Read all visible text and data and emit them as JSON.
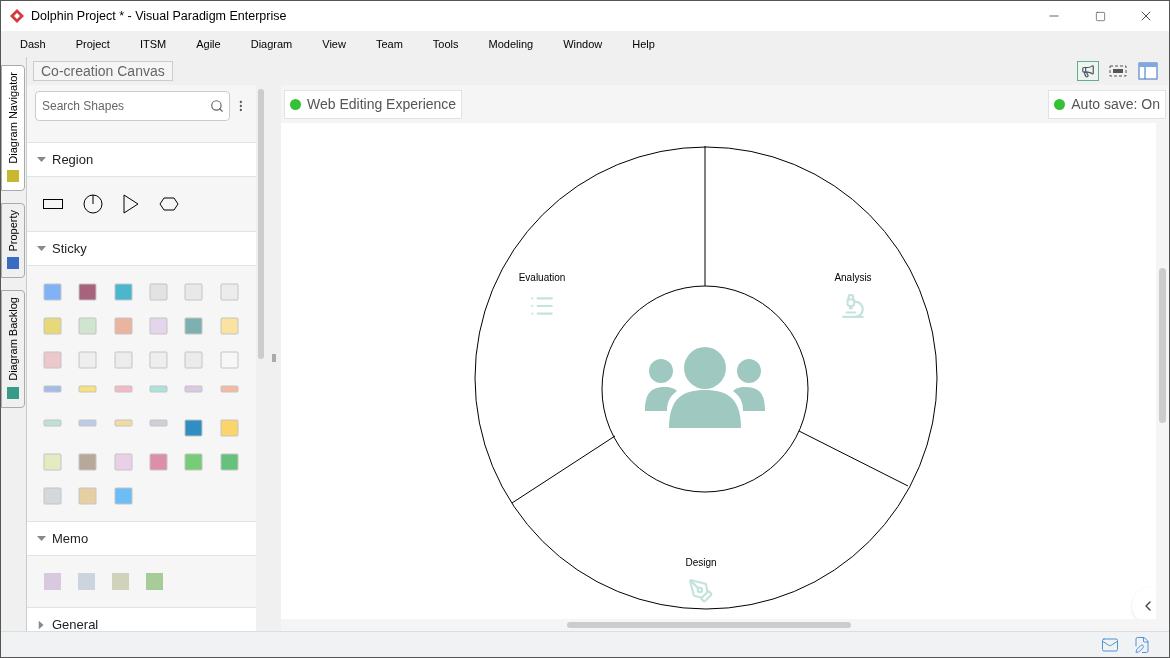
{
  "window": {
    "title": "Dolphin Project * - Visual Paradigm Enterprise"
  },
  "menu": [
    "Dash",
    "Project",
    "ITSM",
    "Agile",
    "Diagram",
    "View",
    "Team",
    "Tools",
    "Modeling",
    "Window",
    "Help"
  ],
  "side_tabs": [
    {
      "label": "Diagram Navigator",
      "selected": true
    },
    {
      "label": "Property",
      "selected": false
    },
    {
      "label": "Diagram Backlog",
      "selected": false
    }
  ],
  "breadcrumb": "Co-creation Canvas",
  "search": {
    "placeholder": "Search Shapes"
  },
  "sections": [
    {
      "title": "Region",
      "expanded": true,
      "kind": "region"
    },
    {
      "title": "Sticky",
      "expanded": true,
      "kind": "sticky"
    },
    {
      "title": "Memo",
      "expanded": true,
      "kind": "memo"
    },
    {
      "title": "General",
      "expanded": false
    }
  ],
  "status_pills": [
    {
      "label": "Web Editing Experience",
      "color": "#33c233"
    },
    {
      "label": "Auto save: On",
      "color": "#33c233"
    }
  ],
  "diagram": {
    "segments": [
      {
        "label": "Evaluation",
        "kind": "list"
      },
      {
        "label": "Analysis",
        "kind": "microscope"
      },
      {
        "label": "Design",
        "kind": "pen"
      }
    ]
  }
}
